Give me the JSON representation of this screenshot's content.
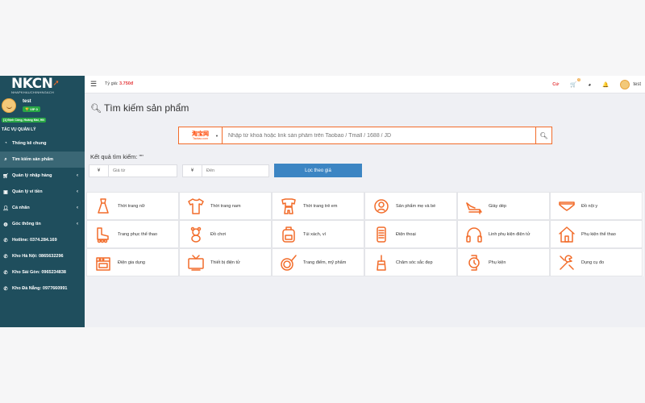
{
  "colors": {
    "sidebar": "#1f4e5d",
    "accent": "#f26c2a",
    "primary_button": "#3c85c3",
    "badge_green": "#28a745",
    "price": "#e4393c"
  },
  "brand": {
    "logo_text": "NKCN",
    "logo_sub": "NHAPKHAUCHINHNGACH"
  },
  "user": {
    "name": "test",
    "vip": "VIP 0",
    "address": "[1] Định Công, Hoàng Mai, HN"
  },
  "sidebar": {
    "section_title": "TÁC VỤ QUẢN LÝ",
    "items": [
      {
        "label": "Thống kê chung",
        "icon": "dashboard-icon"
      },
      {
        "label": "Tìm kiếm sản phẩm",
        "icon": "search-icon",
        "active": true
      },
      {
        "label": "Quản lý nhập hàng",
        "icon": "cart-icon",
        "chevron": true
      },
      {
        "label": "Quản lý ví tiền",
        "icon": "wallet-icon",
        "chevron": true
      },
      {
        "label": "Cá nhân",
        "icon": "user-icon",
        "chevron": true
      },
      {
        "label": "Góc thông tin",
        "icon": "globe-icon",
        "chevron": true
      },
      {
        "label": "Hotline: 0374.284.169",
        "icon": "phone-icon"
      },
      {
        "label": "Kho Hà Nội: 0865632296",
        "icon": "phone-icon"
      },
      {
        "label": "Kho Sài Gòn: 0965234838",
        "icon": "phone-icon"
      },
      {
        "label": "Kho Đà Nẵng: 0977660991",
        "icon": "phone-icon"
      }
    ]
  },
  "topbar": {
    "rate_label": "Tỷ giá:",
    "rate_value": "3.750đ",
    "currency": "Cứ",
    "cart_count": "0",
    "user": "test"
  },
  "page_title": "Tìm kiếm sản phẩm",
  "search": {
    "source_name": "淘宝网",
    "source_sub": "Taobao.com",
    "placeholder": "Nhập từ khoá hoặc link sản phẩm trên Taobao / Tmall / 1688 / JD"
  },
  "results": {
    "label": "Kết quả tìm kiếm: \"\""
  },
  "filter": {
    "currency_symbol": "¥",
    "from_placeholder": "Giá từ",
    "to_placeholder": "Đến",
    "button": "Lọc theo giá"
  },
  "categories": [
    {
      "label": "Thời trang nữ",
      "icon": "dress-icon"
    },
    {
      "label": "Thời trang nam",
      "icon": "shirt-icon"
    },
    {
      "label": "Thời trang trẻ em",
      "icon": "kids-clothes-icon"
    },
    {
      "label": "Sản phẩm mẹ và bé",
      "icon": "baby-icon"
    },
    {
      "label": "Giày dép",
      "icon": "heel-shoe-icon"
    },
    {
      "label": "Đồ nội y",
      "icon": "underwear-icon"
    },
    {
      "label": "Trang phục thể thao",
      "icon": "roller-skate-icon"
    },
    {
      "label": "Đồ chơi",
      "icon": "teddy-bear-icon"
    },
    {
      "label": "Túi xách, ví",
      "icon": "backpack-icon"
    },
    {
      "label": "Điện thoại",
      "icon": "phone-device-icon"
    },
    {
      "label": "Linh phụ kiện điện tử",
      "icon": "headphones-icon"
    },
    {
      "label": "Phụ kiện thể thao",
      "icon": "house-icon"
    },
    {
      "label": "Điện gia dụng",
      "icon": "stove-icon"
    },
    {
      "label": "Thiết bị điện tử",
      "icon": "tv-icon"
    },
    {
      "label": "Trang điểm, mỹ phẩm",
      "icon": "cosmetics-icon"
    },
    {
      "label": "Chăm sóc sắc đẹp",
      "icon": "beauty-care-icon"
    },
    {
      "label": "Phụ kiện",
      "icon": "watch-icon"
    },
    {
      "label": "Dụng cụ đo",
      "icon": "tools-icon"
    }
  ]
}
